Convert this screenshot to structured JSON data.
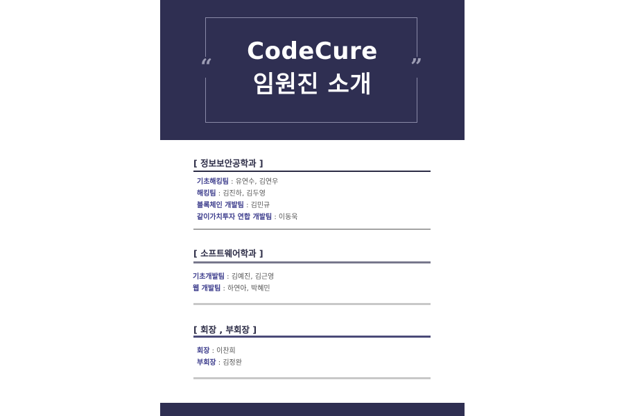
{
  "header": {
    "title_line1": "CodeCure",
    "title_line2": "임원진 소개",
    "open_quote": "“",
    "close_quote": "”"
  },
  "sections": [
    {
      "heading": "[ 정보보안공학과 ]",
      "items": [
        {
          "team": "기초해킹팀",
          "sep": " : ",
          "names": "유연수, 김연우"
        },
        {
          "team": "해킹팀",
          "sep": " : ",
          "names": "김진하, 김두영"
        },
        {
          "team": "블록체인 개발팀",
          "sep": " : ",
          "names": "김민규"
        },
        {
          "team": "같이가치투자 연합 개발팀",
          "sep": " : ",
          "names": "이동욱"
        }
      ]
    },
    {
      "heading": "[ 소프트웨어학과 ]",
      "items": [
        {
          "team": "기초개발팀",
          "sep": " : ",
          "names": "김예진, 김근영"
        },
        {
          "team": "웹 개발팀",
          "sep": " : ",
          "names": "하연아, 박혜민"
        }
      ]
    },
    {
      "heading": "[ 회장 , 부회장 ]",
      "items": [
        {
          "team": "회장",
          "sep": " : ",
          "names": "이찬희"
        },
        {
          "team": "부회장",
          "sep": " : ",
          "names": "김정완"
        }
      ]
    }
  ],
  "colors": {
    "navy": "#2f2f52",
    "team_text": "#3c3c8c",
    "rule_gray": "#c8c8c8"
  }
}
